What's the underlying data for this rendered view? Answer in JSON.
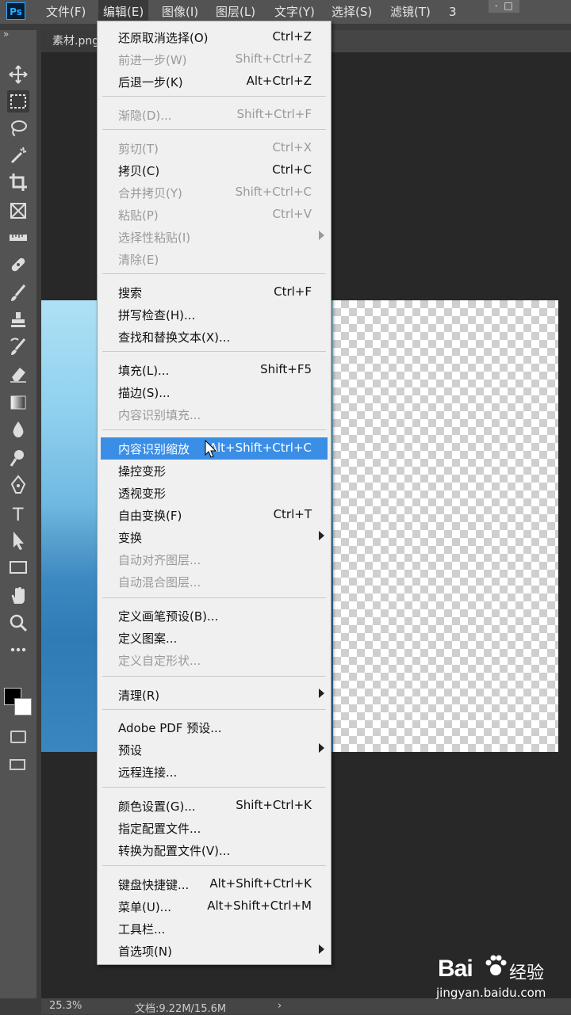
{
  "menubar": {
    "logo": "Ps",
    "items": [
      "文件(F)",
      "编辑(E)",
      "图像(I)",
      "图层(L)",
      "文字(Y)",
      "选择(S)",
      "滤镜(T)",
      "3"
    ],
    "active_index": 1,
    "window_min": "—",
    "window_max": "□"
  },
  "toolbar": {
    "collapse": "»",
    "tools": [
      "move-icon",
      "marquee-icon",
      "lasso-icon",
      "magic-wand-icon",
      "crop-icon",
      "frame-icon",
      "ruler-icon",
      "healing-icon",
      "brush-icon",
      "stamp-icon",
      "history-brush-icon",
      "eraser-icon",
      "gradient-icon",
      "blur-icon",
      "dodge-icon",
      "pen-icon",
      "type-icon",
      "path-select-icon",
      "rectangle-icon",
      "hand-icon",
      "zoom-icon",
      "more-icon"
    ],
    "type_tool_glyph": "T",
    "more_glyph": "•••",
    "foreground_color": "#000000",
    "background_color": "#ffffff"
  },
  "document": {
    "tab_label": "素材.png",
    "checker_colors": [
      "#ffffff",
      "#cfcfcf"
    ]
  },
  "status": {
    "zoom": "25.3%",
    "doc_info": "文档:9.22M/15.6M",
    "arrow": "›"
  },
  "edit_menu": {
    "items": [
      {
        "label": "还原取消选择(O)",
        "shortcut": "Ctrl+Z",
        "disabled": false
      },
      {
        "label": "前进一步(W)",
        "shortcut": "Shift+Ctrl+Z",
        "disabled": true
      },
      {
        "label": "后退一步(K)",
        "shortcut": "Alt+Ctrl+Z",
        "disabled": false
      },
      {
        "label": "渐隐(D)...",
        "shortcut": "Shift+Ctrl+F",
        "disabled": true
      },
      {
        "label": "剪切(T)",
        "shortcut": "Ctrl+X",
        "disabled": true
      },
      {
        "label": "拷贝(C)",
        "shortcut": "Ctrl+C",
        "disabled": false
      },
      {
        "label": "合并拷贝(Y)",
        "shortcut": "Shift+Ctrl+C",
        "disabled": true
      },
      {
        "label": "粘贴(P)",
        "shortcut": "Ctrl+V",
        "disabled": true
      },
      {
        "label": "选择性粘贴(I)",
        "shortcut": "",
        "disabled": true,
        "submenu": true
      },
      {
        "label": "清除(E)",
        "shortcut": "",
        "disabled": true
      },
      {
        "label": "搜索",
        "shortcut": "Ctrl+F",
        "disabled": false
      },
      {
        "label": "拼写检查(H)...",
        "shortcut": "",
        "disabled": false
      },
      {
        "label": "查找和替换文本(X)...",
        "shortcut": "",
        "disabled": false
      },
      {
        "label": "填充(L)...",
        "shortcut": "Shift+F5",
        "disabled": false
      },
      {
        "label": "描边(S)...",
        "shortcut": "",
        "disabled": false
      },
      {
        "label": "内容识别填充...",
        "shortcut": "",
        "disabled": true
      },
      {
        "label": "内容识别缩放",
        "shortcut": "Alt+Shift+Ctrl+C",
        "disabled": false,
        "highlighted": true
      },
      {
        "label": "操控变形",
        "shortcut": "",
        "disabled": false
      },
      {
        "label": "透视变形",
        "shortcut": "",
        "disabled": false
      },
      {
        "label": "自由变换(F)",
        "shortcut": "Ctrl+T",
        "disabled": false
      },
      {
        "label": "变换",
        "shortcut": "",
        "disabled": false,
        "submenu": true
      },
      {
        "label": "自动对齐图层...",
        "shortcut": "",
        "disabled": true
      },
      {
        "label": "自动混合图层...",
        "shortcut": "",
        "disabled": true
      },
      {
        "label": "定义画笔预设(B)...",
        "shortcut": "",
        "disabled": false
      },
      {
        "label": "定义图案...",
        "shortcut": "",
        "disabled": false
      },
      {
        "label": "定义自定形状...",
        "shortcut": "",
        "disabled": true
      },
      {
        "label": "清理(R)",
        "shortcut": "",
        "disabled": false,
        "submenu": true
      },
      {
        "label": "Adobe PDF 预设...",
        "shortcut": "",
        "disabled": false
      },
      {
        "label": "预设",
        "shortcut": "",
        "disabled": false,
        "submenu": true
      },
      {
        "label": "远程连接...",
        "shortcut": "",
        "disabled": false
      },
      {
        "label": "颜色设置(G)...",
        "shortcut": "Shift+Ctrl+K",
        "disabled": false
      },
      {
        "label": "指定配置文件...",
        "shortcut": "",
        "disabled": false
      },
      {
        "label": "转换为配置文件(V)...",
        "shortcut": "",
        "disabled": false
      },
      {
        "label": "键盘快捷键...",
        "shortcut": "Alt+Shift+Ctrl+K",
        "disabled": false
      },
      {
        "label": "菜单(U)...",
        "shortcut": "Alt+Shift+Ctrl+M",
        "disabled": false
      },
      {
        "label": "工具栏...",
        "shortcut": "",
        "disabled": false
      },
      {
        "label": "首选项(N)",
        "shortcut": "",
        "disabled": false,
        "submenu": true
      }
    ]
  },
  "watermark": {
    "brand": "Bai",
    "brand_suffix": "经验",
    "url": "jingyan.baidu.com"
  }
}
